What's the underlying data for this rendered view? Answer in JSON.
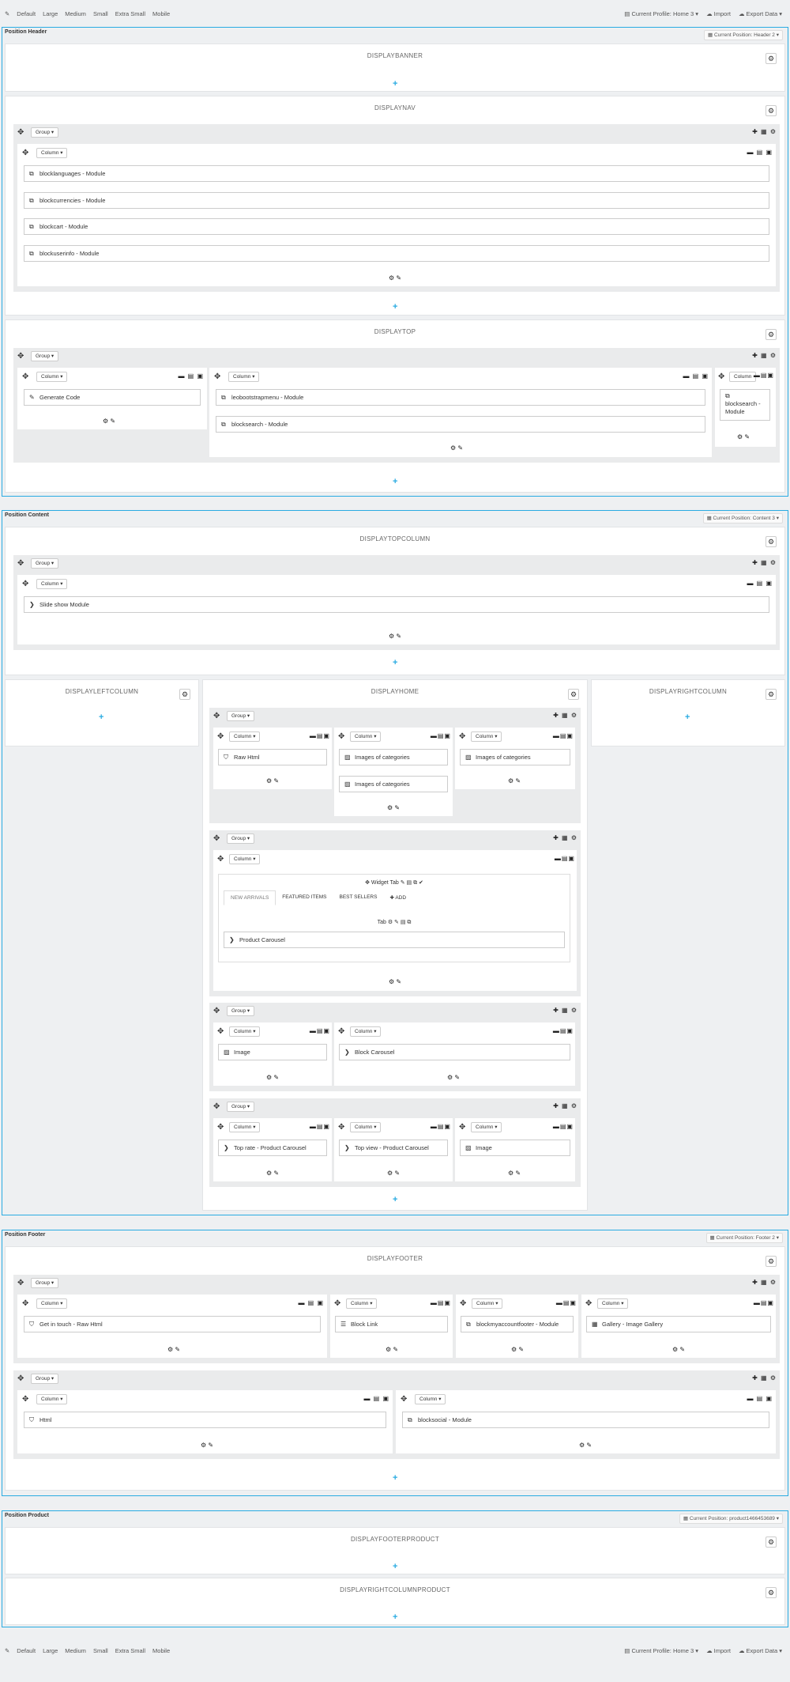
{
  "toolbar": {
    "items": [
      "Default",
      "Large",
      "Medium",
      "Small",
      "Extra Small",
      "Mobile"
    ],
    "profile": "Current Profile: Home 3",
    "profile_bottom": "Current Profile: Home 3",
    "import": "Import",
    "export": "Export Data"
  },
  "header": {
    "title": "Position Header",
    "position": "Current Position: Header 2"
  },
  "content": {
    "title": "Position Content",
    "position": "Current Position: Content 3"
  },
  "footer": {
    "title": "Position Footer",
    "position": "Current Position: Footer 2"
  },
  "product": {
    "title": "Position Product",
    "position": "Current Position: product1466453689"
  },
  "hooks": {
    "banner": "DISPLAYBANNER",
    "nav": "DISPLAYNAV",
    "top": "DISPLAYTOP",
    "topcolumn": "DISPLAYTOPCOLUMN",
    "leftcolumn": "DISPLAYLEFTCOLUMN",
    "home": "DISPLAYHOME",
    "rightcolumn": "DISPLAYRIGHTCOLUMN",
    "footer": "DISPLAYFOOTER",
    "footerproduct": "DISPLAYFOOTERPRODUCT",
    "rightcolumnproduct": "DISPLAYRIGHTCOLUMNPRODUCT"
  },
  "labels": {
    "group": "Group",
    "column": "Column"
  },
  "widgets": {
    "blocklanguages": "blocklanguages - Module",
    "blockcurrencies": "blockcurrencies - Module",
    "blockcart": "blockcart - Module",
    "blockuserinfo": "blockuserinfo - Module",
    "generate": "Generate Code",
    "leobootstrapmenu": "leobootstrapmenu - Module",
    "blocksearch": "blocksearch - Module",
    "blocksearch_short": "blocksearch - Module",
    "slideshow": "Slide show Module",
    "rawhtml": "Raw Html",
    "imgcat1": "Images of categories",
    "imgcat2": "Images of categories",
    "imgcat3": "Images of categories",
    "productcarousel": "Product Carousel",
    "image1": "Image",
    "blockcarousel": "Block Carousel",
    "toprate": "Top rate - Product Carousel",
    "topview": "Top view - Product Carousel",
    "image2": "Image",
    "getintouch": "Get in touch - Raw Html",
    "blocklink": "Block Link",
    "blockmyaccount": "blockmyaccountfooter - Module",
    "gallery": "Gallery - Image Gallery",
    "html": "Html",
    "blocksocial": "blocksocial - Module"
  },
  "widget_tab": {
    "title": "Widget Tab",
    "tabs": [
      "NEW ARRIVALS",
      "FEATURED ITEMS",
      "BEST SELLERS",
      "ADD"
    ],
    "tab_label": "Tab"
  },
  "icons": {
    "gear": "gear-icon",
    "plus": "plus-icon",
    "move": "move-icon",
    "edit": "pencil-icon",
    "module": "module-icon"
  }
}
